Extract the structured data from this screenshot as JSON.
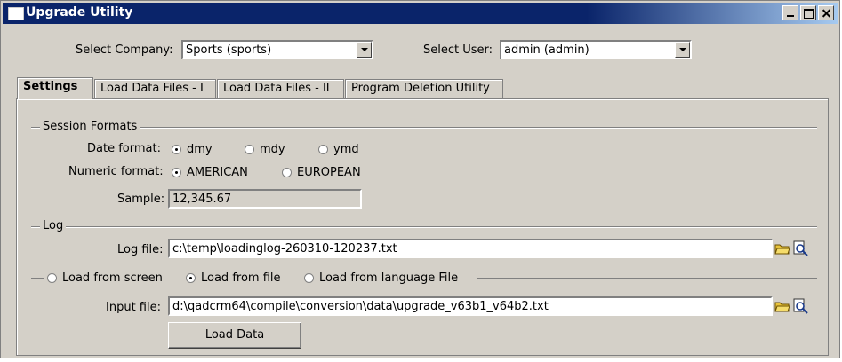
{
  "window": {
    "title": "Upgrade Utility"
  },
  "header": {
    "company_label": "Select Company:",
    "company_value": "Sports (sports)",
    "user_label": "Select User:",
    "user_value": "admin (admin)"
  },
  "tabs": [
    {
      "label": "Settings",
      "active": true
    },
    {
      "label": "Load Data Files - I",
      "active": false
    },
    {
      "label": "Load Data Files - II",
      "active": false
    },
    {
      "label": "Program Deletion Utility",
      "active": false
    }
  ],
  "session_formats": {
    "title": "Session Formats",
    "date_label": "Date format:",
    "date_options": [
      "dmy",
      "mdy",
      "ymd"
    ],
    "date_selected": "dmy",
    "numeric_label": "Numeric format:",
    "numeric_options": [
      "AMERICAN",
      "EUROPEAN"
    ],
    "numeric_selected": "AMERICAN",
    "sample_label": "Sample:",
    "sample_value": "12,345.67"
  },
  "log": {
    "title": "Log",
    "file_label": "Log file:",
    "file_value": "c:\\temp\\loadinglog-260310-120237.txt"
  },
  "load": {
    "options": [
      "Load from screen",
      "Load from file",
      "Load from language File"
    ],
    "selected": "Load from file",
    "input_label": "Input file:",
    "input_value": "d:\\qadcrm64\\compile\\conversion\\data\\upgrade_v63b1_v64b2.txt",
    "button_label": "Load Data"
  },
  "icons": {
    "folder": "open-folder-icon",
    "view": "magnifier-page-icon"
  }
}
